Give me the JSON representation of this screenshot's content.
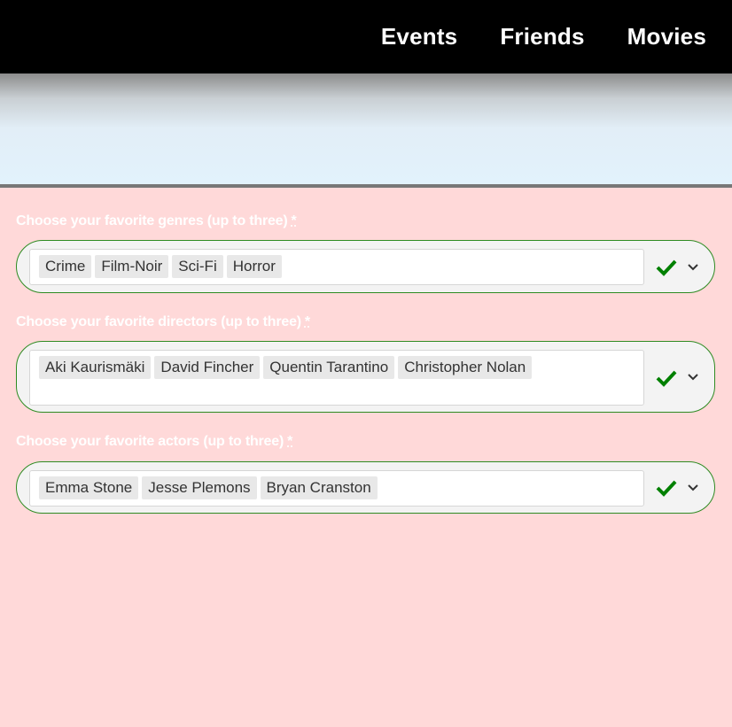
{
  "nav": {
    "items": [
      {
        "label": "Events"
      },
      {
        "label": "Friends"
      },
      {
        "label": "Movies"
      }
    ]
  },
  "fields": [
    {
      "label": "Choose your favorite genres (up to three)",
      "required_mark": "*",
      "tags": [
        "Crime",
        "Film-Noir",
        "Sci-Fi",
        "Horror"
      ]
    },
    {
      "label": "Choose your favorite directors (up to three)",
      "required_mark": "*",
      "tags": [
        "Aki Kaurismäki",
        "David Fincher",
        "Quentin Tarantino",
        "Christopher Nolan"
      ]
    },
    {
      "label": "Choose your favorite actors (up to three)",
      "required_mark": "*",
      "tags": [
        "Emma Stone",
        "Jesse Plemons",
        "Bryan Cranston"
      ]
    }
  ],
  "colors": {
    "valid": "#008000",
    "border": "#2e8b22",
    "background": "#ffd9d9"
  },
  "icons": {
    "valid": "check-icon",
    "dropdown": "chevron-down-icon"
  }
}
